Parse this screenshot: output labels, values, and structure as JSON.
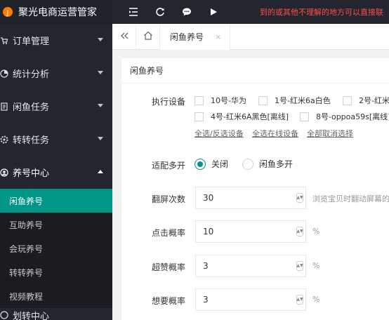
{
  "app": {
    "title": "聚光电商运营管家"
  },
  "colors": {
    "accent": "#009688",
    "sidebar_bg": "#23262e",
    "marquee": "#ff4d4f"
  },
  "sidebar": {
    "items": [
      {
        "label": "订单管理",
        "icon": "cart-icon"
      },
      {
        "label": "统计分析",
        "icon": "chart-icon"
      },
      {
        "label": "闲鱼任务",
        "icon": "tasks-icon"
      },
      {
        "label": "转转任务",
        "icon": "gear-icon"
      },
      {
        "label": "养号中心",
        "icon": "user-icon"
      }
    ],
    "sub_items": [
      "闲鱼养号",
      "互助养号",
      "会玩养号",
      "转转养号",
      "视频教程"
    ],
    "partial_item": "划转中心"
  },
  "header": {
    "marquee": "到的或其他不理解的地方可以直接联"
  },
  "tabs": [
    {
      "label": "闲鱼养号",
      "close": "×"
    }
  ],
  "panel": {
    "title": "闲鱼养号",
    "device_label": "执行设备",
    "devices": [
      "10号-华为",
      "1号-红米6a白色",
      "2号-红米",
      "4号-红米6A黑色[离线]",
      "8号-oppoa59s[离线]"
    ],
    "links": [
      "全选/反选设备",
      "全选在线设备",
      "全部取消选择"
    ],
    "multi_label": "适配多开",
    "multi_options": [
      "关闭",
      "闲鱼多开"
    ],
    "fields": [
      {
        "label": "翻屏次数",
        "value": "30",
        "suffix": "浏览宝贝时翻动屏幕的"
      },
      {
        "label": "点击概率",
        "value": "10",
        "suffix": "%"
      },
      {
        "label": "超赞概率",
        "value": "3",
        "suffix": "%"
      },
      {
        "label": "想要概率",
        "value": "3",
        "suffix": "%"
      }
    ]
  }
}
